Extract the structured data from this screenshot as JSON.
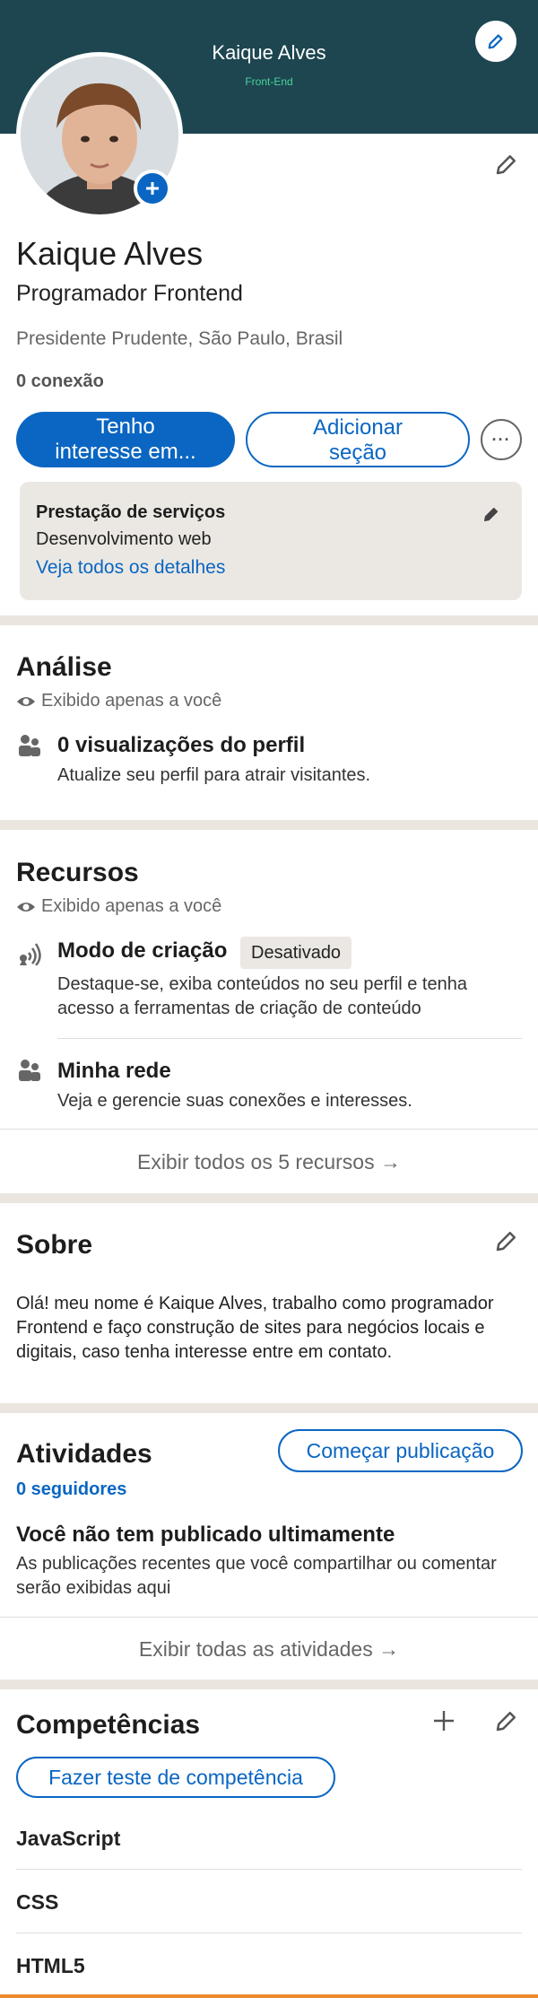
{
  "banner": {
    "name": "Kaique Alves",
    "subtitle": "Front-End"
  },
  "profile": {
    "name": "Kaique Alves",
    "headline": "Programador Frontend",
    "location": "Presidente Prudente, São Paulo, Brasil",
    "connections": "0 conexão",
    "buttons": {
      "interest_line1": "Tenho",
      "interest_line2": "interesse em...",
      "add_section_line1": "Adicionar",
      "add_section_line2": "seção",
      "more": "···"
    }
  },
  "services": {
    "title": "Prestação de serviços",
    "desc": "Desenvolvimento web",
    "link": "Veja todos os detalhes"
  },
  "analytics": {
    "title": "Análise",
    "visibility": "Exibido apenas a você",
    "views_title": "0 visualizações do perfil",
    "views_desc": "Atualize seu perfil para atrair visitantes."
  },
  "resources": {
    "title": "Recursos",
    "visibility": "Exibido apenas a você",
    "creator_title": "Modo de criação",
    "creator_badge": "Desativado",
    "creator_desc1": "Destaque-se, exiba conteúdos no seu perfil e tenha",
    "creator_desc2": "acesso a ferramentas de criação de conteúdo",
    "network_title": "Minha rede",
    "network_desc": "Veja e gerencie suas conexões e interesses.",
    "show_all": "Exibir todos os 5 recursos →"
  },
  "about": {
    "title": "Sobre",
    "text": "Olá! meu nome é Kaique Alves, trabalho como programador Frontend e faço construção de sites para negócios locais e digitais, caso tenha interesse entre em contato."
  },
  "activity": {
    "title": "Atividades",
    "start_post": "Começar publicação",
    "followers": "0 seguidores",
    "empty_title": "Você não tem publicado ultimamente",
    "empty_desc": "As publicações recentes que você compartilhar ou comentar serão exibidas aqui",
    "show_all": "Exibir todas as atividades →"
  },
  "skills": {
    "title": "Competências",
    "test_button": "Fazer teste de competência",
    "items": [
      "JavaScript",
      "CSS",
      "HTML5"
    ]
  },
  "colors": {
    "accent": "#0a66c2",
    "banner": "#1d4650",
    "banner_sub": "#49d39c",
    "divider": "#eae6df"
  }
}
